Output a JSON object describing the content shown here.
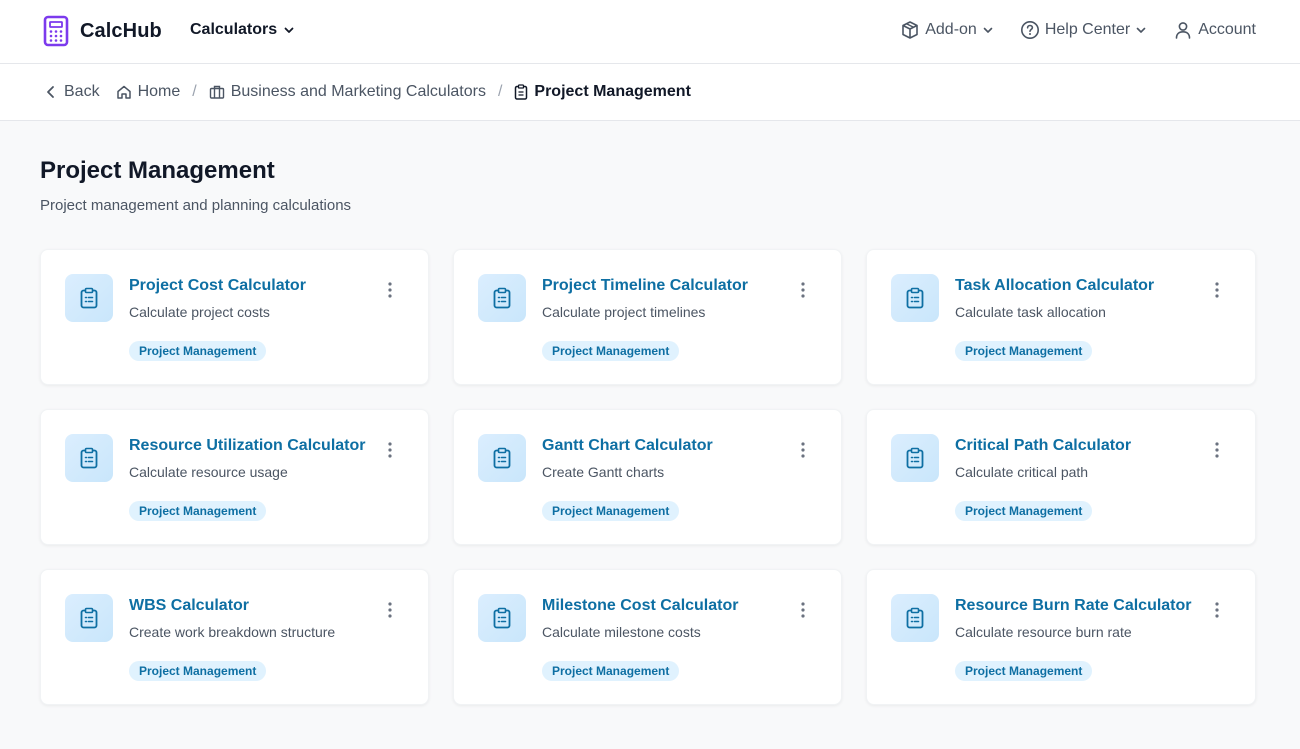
{
  "brand": {
    "name": "CalcHub",
    "color": "#7c3aed"
  },
  "nav": {
    "calculators_label": "Calculators",
    "addon_label": "Add-on",
    "help_label": "Help Center",
    "account_label": "Account"
  },
  "breadcrumb": {
    "back_label": "Back",
    "home_label": "Home",
    "category_label": "Business and Marketing Calculators",
    "current_label": "Project Management",
    "separator": "/"
  },
  "page": {
    "title": "Project Management",
    "subtitle": "Project management and planning calculations"
  },
  "cards": [
    {
      "title": "Project Cost Calculator",
      "desc": "Calculate project costs",
      "tag": "Project Management",
      "icon": "clipboard-icon"
    },
    {
      "title": "Project Timeline Calculator",
      "desc": "Calculate project timelines",
      "tag": "Project Management",
      "icon": "clipboard-icon"
    },
    {
      "title": "Task Allocation Calculator",
      "desc": "Calculate task allocation",
      "tag": "Project Management",
      "icon": "clipboard-icon"
    },
    {
      "title": "Resource Utilization Calculator",
      "desc": "Calculate resource usage",
      "tag": "Project Management",
      "icon": "clipboard-icon"
    },
    {
      "title": "Gantt Chart Calculator",
      "desc": "Create Gantt charts",
      "tag": "Project Management",
      "icon": "clipboard-icon"
    },
    {
      "title": "Critical Path Calculator",
      "desc": "Calculate critical path",
      "tag": "Project Management",
      "icon": "clipboard-icon"
    },
    {
      "title": "WBS Calculator",
      "desc": "Create work breakdown structure",
      "tag": "Project Management",
      "icon": "clipboard-icon"
    },
    {
      "title": "Milestone Cost Calculator",
      "desc": "Calculate milestone costs",
      "tag": "Project Management",
      "icon": "clipboard-icon"
    },
    {
      "title": "Resource Burn Rate Calculator",
      "desc": "Calculate resource burn rate",
      "tag": "Project Management",
      "icon": "clipboard-icon"
    }
  ],
  "colors": {
    "accent": "#0e6fa3",
    "tag_bg": "#e0f2fe",
    "page_bg": "#f8f9fa"
  }
}
